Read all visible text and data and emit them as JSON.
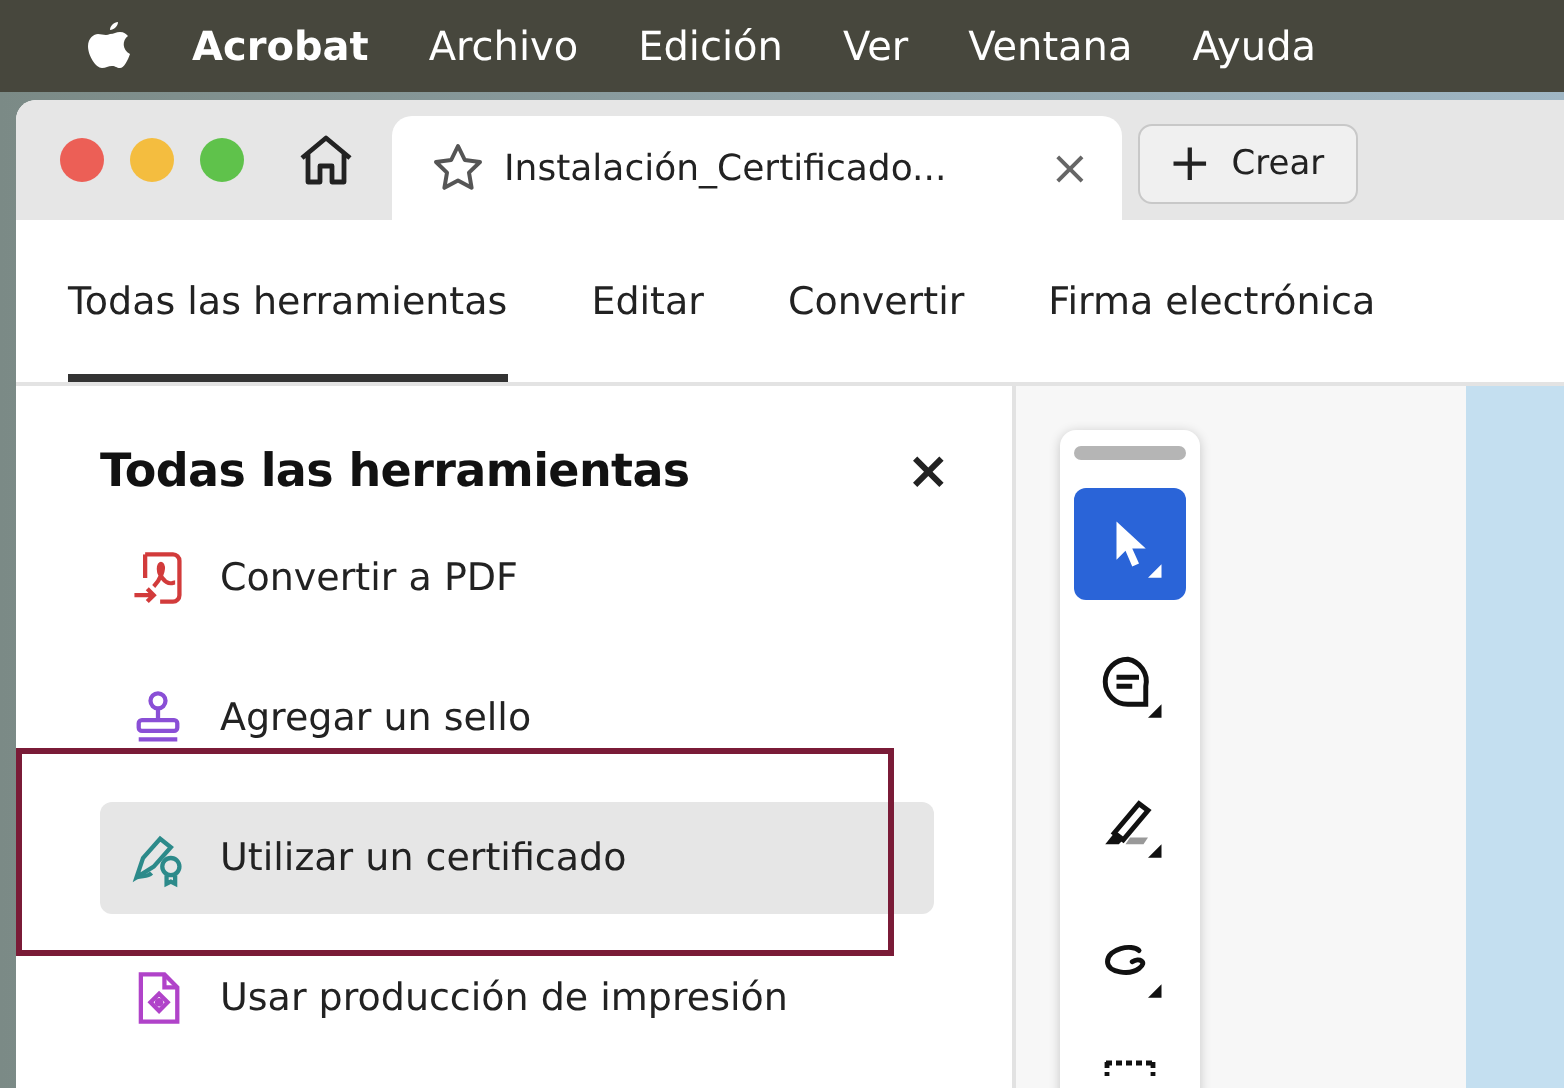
{
  "menu_bar": {
    "app_name": "Acrobat",
    "items": [
      "Archivo",
      "Edición",
      "Ver",
      "Ventana",
      "Ayuda"
    ]
  },
  "tab_strip": {
    "tab": {
      "title": "Instalación_Certificado...",
      "close": "×"
    },
    "create_button": {
      "icon": "+",
      "label": "Crear"
    }
  },
  "tool_tabs": [
    {
      "label": "Todas las herramientas",
      "selected": true
    },
    {
      "label": "Editar",
      "selected": false
    },
    {
      "label": "Convertir",
      "selected": false
    },
    {
      "label": "Firma electrónica",
      "selected": false
    }
  ],
  "panel": {
    "title": "Todas las herramientas",
    "close": "×",
    "items": [
      {
        "kind": "convert",
        "label": "Convertir a PDF",
        "selected": false
      },
      {
        "kind": "stamp",
        "label": "Agregar un sello",
        "selected": false
      },
      {
        "kind": "certificate",
        "label": "Utilizar un certificado",
        "selected": true
      },
      {
        "kind": "print",
        "label": "Usar producción de impresión",
        "selected": false
      }
    ]
  },
  "toolbar": {
    "tools": [
      {
        "kind": "select",
        "selected": true
      },
      {
        "kind": "comment",
        "selected": false
      },
      {
        "kind": "highlight",
        "selected": false
      },
      {
        "kind": "draw",
        "selected": false
      },
      {
        "kind": "area",
        "selected": false
      }
    ]
  }
}
